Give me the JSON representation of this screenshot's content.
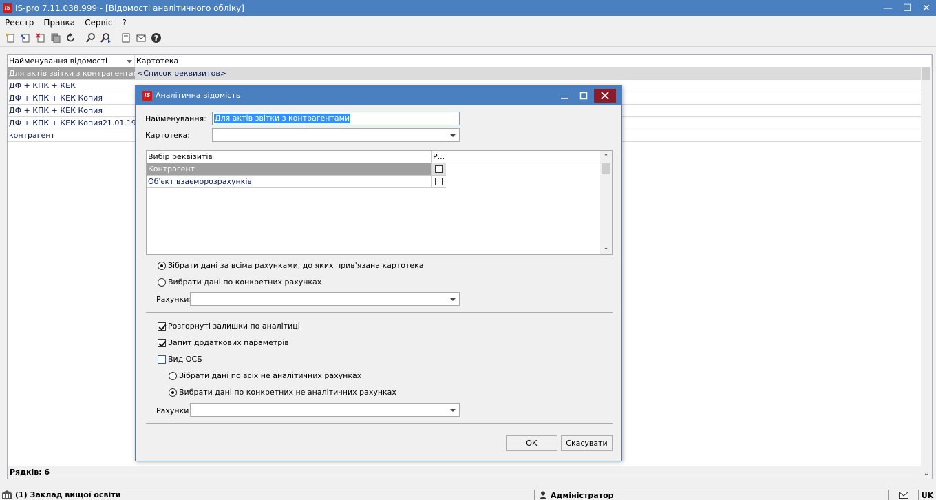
{
  "window": {
    "logo": "IS",
    "title": "IS-pro 7.11.038.999 - [Відомості аналітичного обліку]",
    "minimize": "—",
    "maximize": "☐",
    "close": "✕"
  },
  "menu": [
    "Реєстр",
    "Правка",
    "Сервіс",
    "?"
  ],
  "toolbar_icons": [
    "new-icon",
    "edit-icon",
    "delete-icon",
    "copy-icon",
    "refresh-icon",
    "find-icon",
    "find-next-icon",
    "report-icon",
    "mail-icon",
    "help-icon"
  ],
  "grid": {
    "columns": [
      "Найменування відомості",
      "Картотека"
    ],
    "rows": [
      {
        "name": "Для актів звітки з контрагентами",
        "kartoteka": "<Список реквизитов>"
      },
      {
        "name": "ДФ + КПК + КЕК",
        "kartoteka": ""
      },
      {
        "name": "ДФ + КПК + КЕК Копия",
        "kartoteka": ""
      },
      {
        "name": "ДФ + КПК + КЕК Копия",
        "kartoteka": ""
      },
      {
        "name": "ДФ + КПК + КЕК Копия21.01.19",
        "kartoteka": ""
      },
      {
        "name": "контрагент",
        "kartoteka": ""
      }
    ],
    "footer": "Рядків: 6"
  },
  "statusbar": {
    "org": "(1) Заклад вищої освіти",
    "user": "Адміністратор",
    "lang": "UK"
  },
  "dialog": {
    "logo": "IS",
    "title": "Аналітична відомість",
    "name_label": "Найменування:",
    "name_value": "Для актів звітки з контрагентами",
    "kartoteka_label": "Картотека:",
    "kartoteka_value": "",
    "rek_columns": [
      "Вибір реквізитів",
      "Р..."
    ],
    "rek_rows": [
      {
        "name": "Контрагент",
        "checked": false
      },
      {
        "name": "Об'єкт взаєморозрахунків",
        "checked": false
      }
    ],
    "radio1_label": "Зібрати дані за всіма рахунками, до яких прив'язана картотека",
    "radio2_label": "Вибрати дані по конкретних рахунках",
    "accounts_label": "Рахунки:",
    "accounts_value": "",
    "check1_label": "Розгорнуті залишки по аналітиці",
    "check2_label": "Запит додаткових параметрів",
    "check3_label": "Вид ОСБ",
    "radio3_label": "Зібрати дані по всіх не аналітичних рахунках",
    "radio4_label": "Вибрати дані по конкретних не аналітичних рахунках",
    "accounts2_label": "Рахунки",
    "accounts2_value": "",
    "ok_label": "ОК",
    "cancel_label": "Скасувати"
  }
}
